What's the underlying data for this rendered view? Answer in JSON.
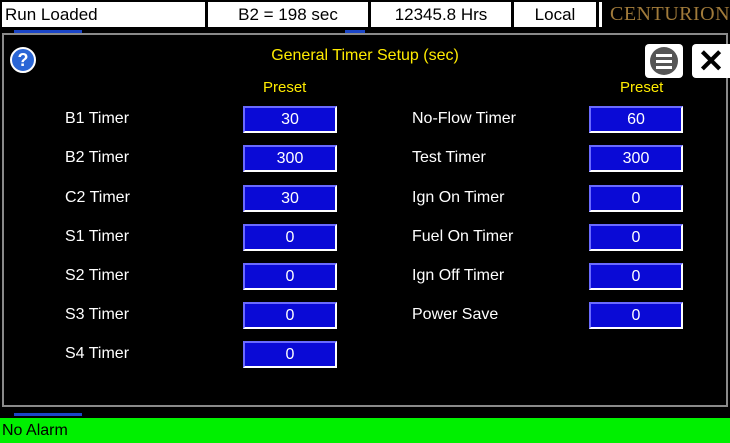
{
  "status_bar": {
    "run_state": "Run Loaded",
    "timer": "B2 = 198 sec",
    "hours": "12345.8 Hrs",
    "mode": "Local",
    "brand": "CENTURION"
  },
  "panel": {
    "title": "General Timer Setup (sec)",
    "help_icon": "?",
    "menu_icon": "hamburger-menu",
    "close_icon": "✕",
    "left_header": "Preset",
    "right_header": "Preset"
  },
  "left_timers": [
    {
      "label": "B1 Timer",
      "value": "30"
    },
    {
      "label": "B2 Timer",
      "value": "300"
    },
    {
      "label": "C2 Timer",
      "value": "30"
    },
    {
      "label": "S1 Timer",
      "value": "0"
    },
    {
      "label": "S2 Timer",
      "value": "0"
    },
    {
      "label": "S3 Timer",
      "value": "0"
    },
    {
      "label": "S4 Timer",
      "value": "0"
    }
  ],
  "right_timers": [
    {
      "label": "No-Flow Timer",
      "value": "60"
    },
    {
      "label": "Test Timer",
      "value": "300"
    },
    {
      "label": "Ign On Timer",
      "value": "0"
    },
    {
      "label": "Fuel On Timer",
      "value": "0"
    },
    {
      "label": "Ign Off Timer",
      "value": "0"
    },
    {
      "label": "Power Save",
      "value": "0"
    }
  ],
  "alarm_bar": {
    "text": "No Alarm",
    "color": "#00f000"
  },
  "colors": {
    "field_bg": "#0a0ad6",
    "title": "#ffeb00",
    "brand": "#a07a3a"
  }
}
